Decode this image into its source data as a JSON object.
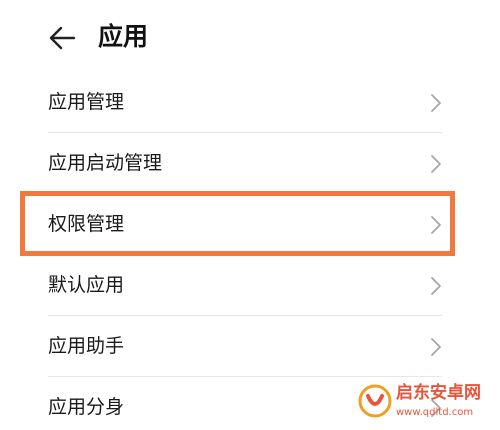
{
  "header": {
    "back_icon": "arrow-left-icon",
    "title": "应用"
  },
  "settings_list": {
    "items": [
      {
        "label": "应用管理",
        "icon": "chevron-right-icon"
      },
      {
        "label": "应用启动管理",
        "icon": "chevron-right-icon"
      },
      {
        "label": "权限管理",
        "icon": "chevron-right-icon",
        "highlighted": true
      },
      {
        "label": "默认应用",
        "icon": "chevron-right-icon"
      },
      {
        "label": "应用助手",
        "icon": "chevron-right-icon"
      },
      {
        "label": "应用分身",
        "icon": "chevron-right-icon"
      }
    ]
  },
  "annotation": {
    "highlight_color": "#f07a3e"
  },
  "watermark": {
    "name": "启东安卓网",
    "url": "www.qdltd.com",
    "color": "#e8543a"
  }
}
